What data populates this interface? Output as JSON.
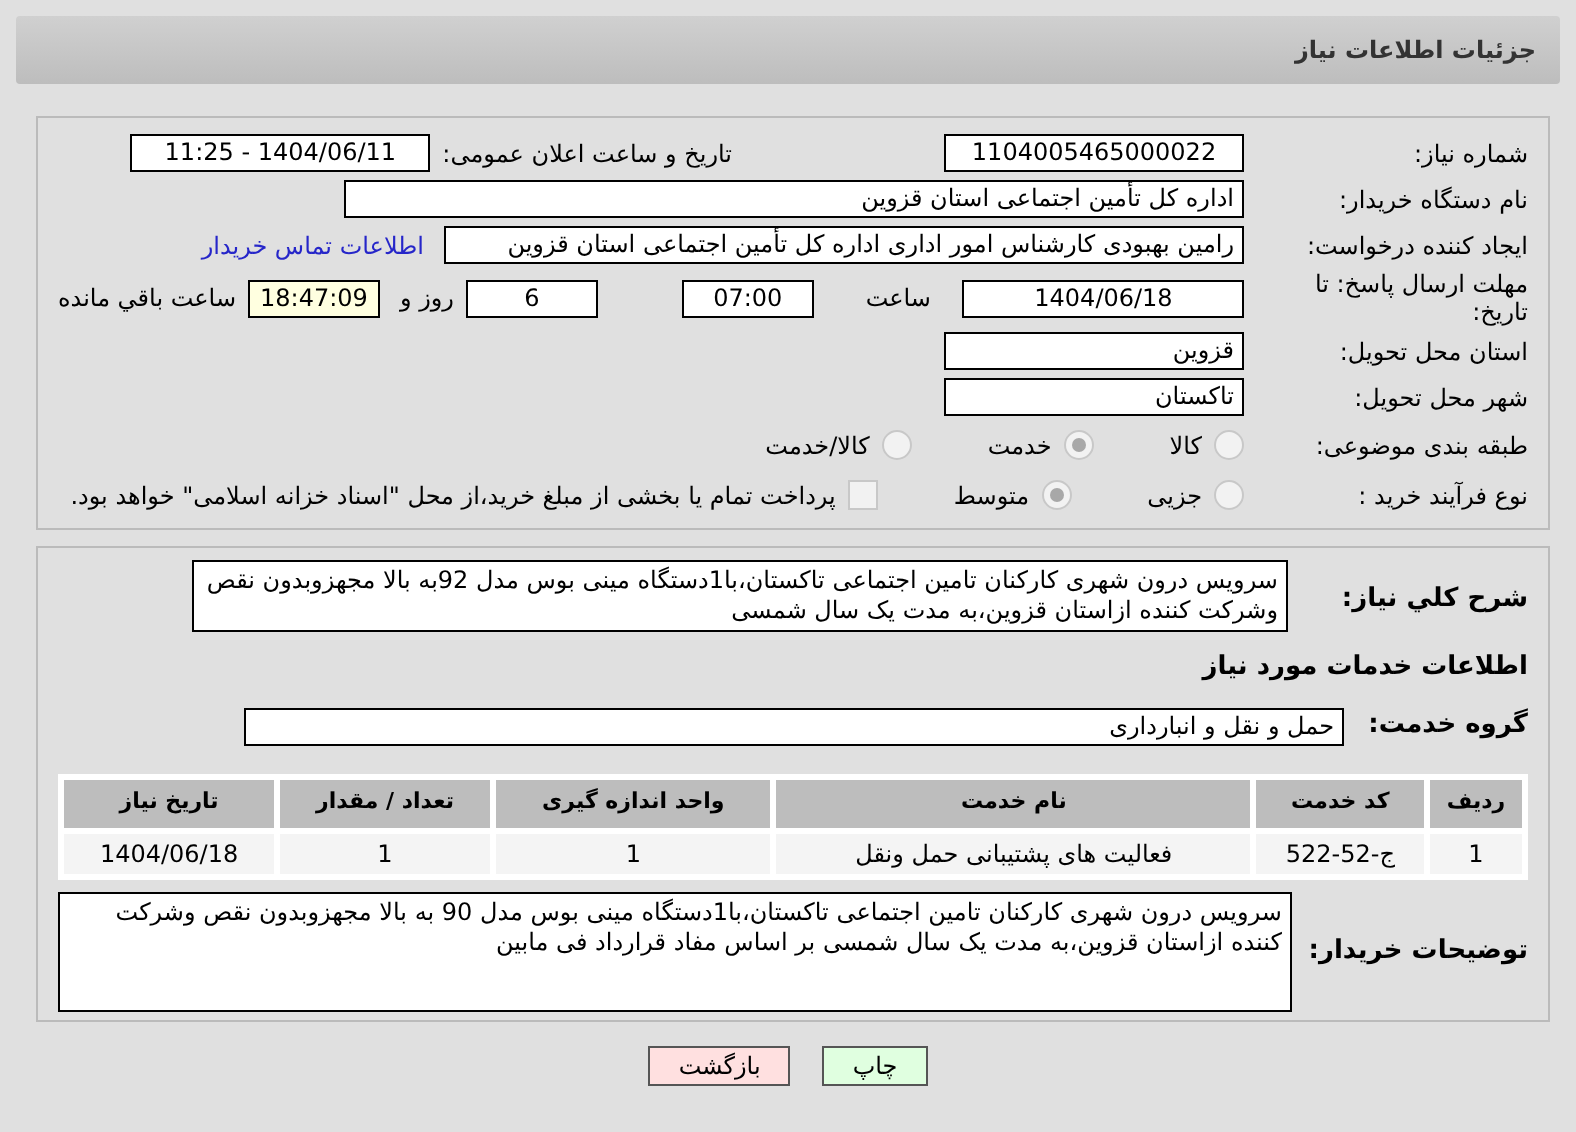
{
  "title": "جزئیات اطلاعات نیاز",
  "need_number": {
    "label": "شماره نیاز:",
    "value": "1104005465000022"
  },
  "announce": {
    "label": "تاریخ و ساعت اعلان عمومی:",
    "value": "1404/06/11 - 11:25"
  },
  "buyer_org": {
    "label": "نام دستگاه خریدار:",
    "value": "اداره کل تأمین اجتماعی استان قزوین"
  },
  "requester": {
    "label": "ایجاد کننده درخواست:",
    "value": "رامین بهبودی کارشناس امور اداری اداره کل تأمین اجتماعی استان قزوین",
    "link": "اطلاعات تماس خریدار"
  },
  "deadline": {
    "label": "مهلت ارسال پاسخ: تا تاریخ:",
    "date": "1404/06/18",
    "time_label": "ساعت",
    "time": "07:00",
    "days": "6",
    "days_label": "روز و",
    "remaining": "18:47:09",
    "remaining_label": "ساعت باقي مانده"
  },
  "province": {
    "label": "استان محل تحویل:",
    "value": "قزوین"
  },
  "city": {
    "label": "شهر محل تحویل:",
    "value": "تاکستان"
  },
  "category": {
    "label": "طبقه بندی موضوعی:",
    "options": [
      {
        "label": "کالا",
        "selected": false
      },
      {
        "label": "خدمت",
        "selected": true
      },
      {
        "label": "کالا/خدمت",
        "selected": false
      }
    ]
  },
  "process": {
    "label": "نوع فرآیند خرید :",
    "options": [
      {
        "label": "جزیی",
        "selected": false
      },
      {
        "label": "متوسط",
        "selected": true
      }
    ],
    "treasury": {
      "label": "پرداخت تمام یا بخشی از مبلغ خرید،از محل \"اسناد خزانه اسلامی\" خواهد بود.",
      "checked": false
    }
  },
  "description": {
    "label": "شرح کلي نیاز:",
    "text": "سرویس درون شهری کارکنان تامین اجتماعی تاکستان،با1دستگاه مینی بوس مدل 92به بالا مجهزوبدون نقص وشرکت کننده  ازاستان قزوین،به مدت یک سال شمسی"
  },
  "services_heading": "اطلاعات خدمات مورد نیاز",
  "service_group": {
    "label": "گروه خدمت:",
    "value": "حمل و نقل و انبارداری"
  },
  "table": {
    "columns": [
      "ردیف",
      "کد خدمت",
      "نام خدمت",
      "واحد اندازه گیری",
      "تعداد / مقدار",
      "تاریخ نیاز"
    ],
    "rows": [
      [
        "1",
        "ج-52-522",
        "فعالیت های پشتیبانی حمل ونقل",
        "1",
        "1",
        "1404/06/18"
      ]
    ]
  },
  "buyer_notes": {
    "label": "توضیحات خریدار:",
    "text": "سرویس درون شهری کارکنان تامین اجتماعی تاکستان،با1دستگاه مینی بوس مدل 90 به بالا مجهزوبدون نقص وشرکت کننده ازاستان قزوین،به مدت یک سال شمسی بر اساس مفاد قرارداد فی مابین"
  },
  "buttons": [
    {
      "label": "چاپ",
      "kind": "print"
    },
    {
      "label": "بازگشت",
      "kind": "back"
    }
  ]
}
